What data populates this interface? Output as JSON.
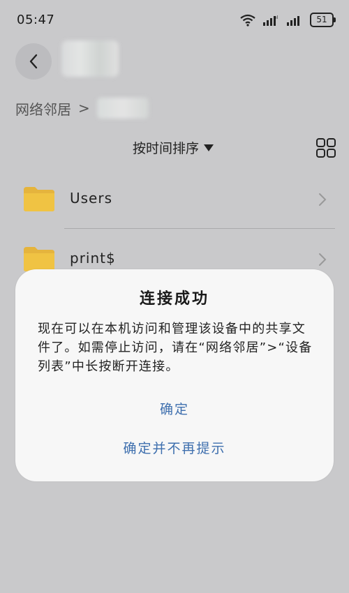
{
  "status_bar": {
    "time": "05:47",
    "battery": "51",
    "icons": [
      "wifi-icon",
      "signal-icon",
      "signal-icon",
      "battery-icon"
    ]
  },
  "header": {
    "back_icon": "chevron-left-icon"
  },
  "breadcrumb": {
    "root": "网络邻居",
    "separator": ">"
  },
  "toolbar": {
    "sort_label": "按时间排序",
    "sort_icon": "triangle-down-icon",
    "view_icon": "grid-view-icon"
  },
  "files": [
    {
      "name": "Users",
      "icon": "folder-icon"
    },
    {
      "name": "print$",
      "icon": "folder-icon"
    }
  ],
  "dialog": {
    "title": "连接成功",
    "message": "现在可以在本机访问和管理该设备中的共享文件了。如需停止访问，请在“网络邻居”>“设备列表”中长按断开连接。",
    "confirm_label": "确定",
    "confirm_no_remind_label": "确定并不再提示"
  },
  "colors": {
    "background": "#c9c9cb",
    "dialog_background": "#f7f7f7",
    "accent": "#3e6fae",
    "folder": "#f0c343"
  }
}
